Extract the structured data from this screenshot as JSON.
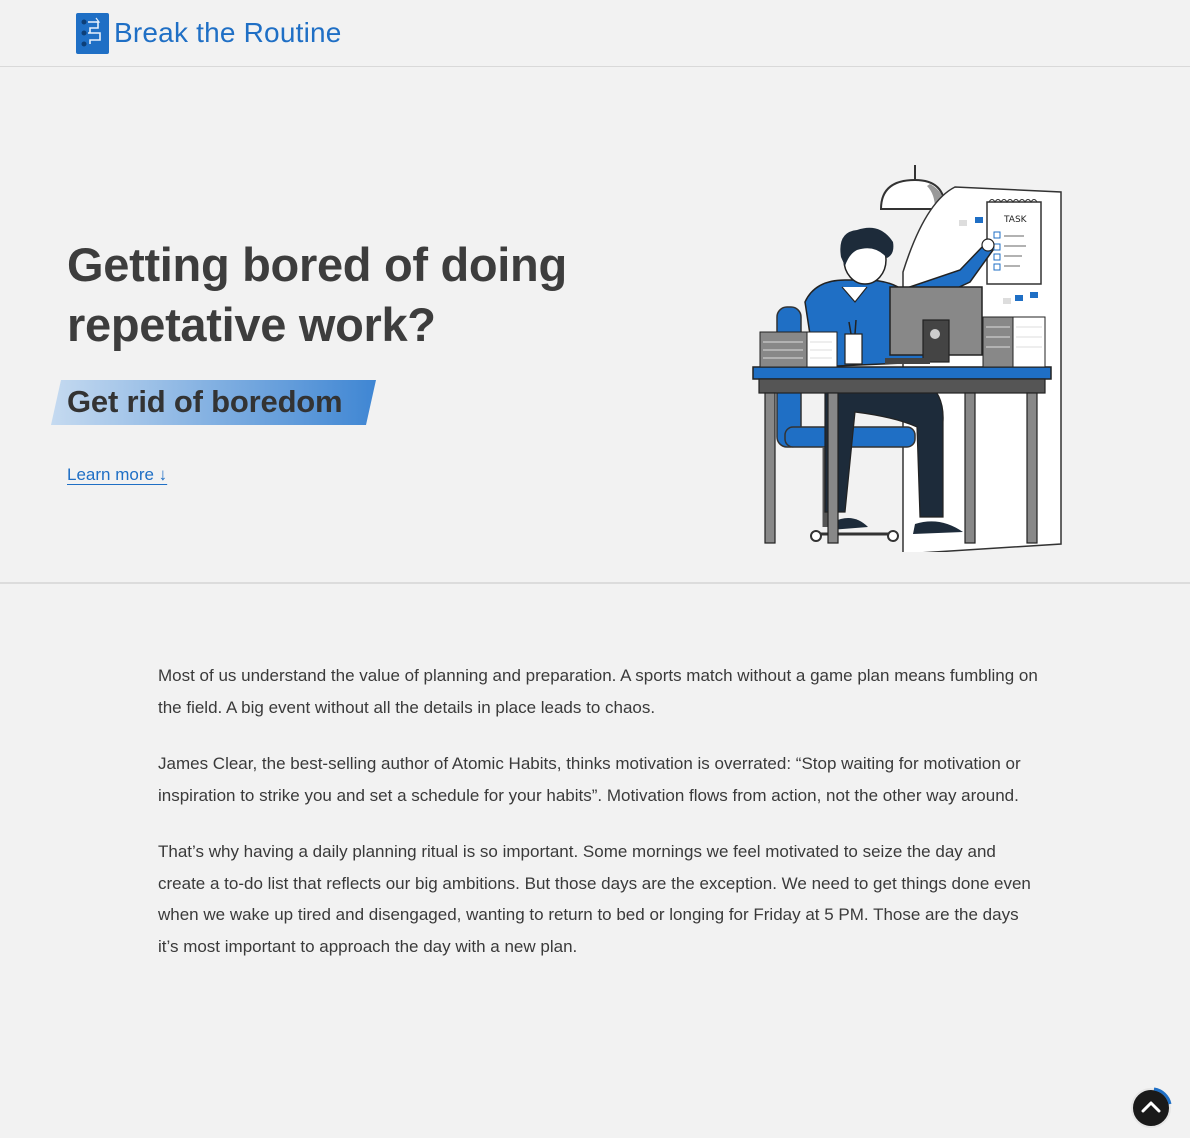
{
  "header": {
    "brand": "Break the Routine",
    "logo_icon": "flowchart-icon"
  },
  "hero": {
    "title": "Getting bored of doing repetative work?",
    "tagline": "Get rid of boredom",
    "learn_more": "Learn more ↓",
    "illustration": {
      "task_board_title": "TASK"
    }
  },
  "article": {
    "paragraphs": [
      "Most of us understand the value of planning and preparation. A sports match without a game plan means fumbling on the field. A big event without all the details in place leads to chaos.",
      "James Clear, the best-selling author of Atomic Habits, thinks motivation is overrated: “Stop waiting for motivation or inspiration to strike you and set a schedule for your habits”. Motivation flows from action, not the other way around.",
      "That’s why having a daily planning ritual is so important. Some mornings we feel motivated to seize the day and create a to-do list that reflects our big ambitions. But those days are the exception. We need to get things done even when we wake up tired and disengaged, wanting to return to bed or longing for Friday at 5 PM. Those are the days it’s most important to approach the day with a new plan."
    ]
  },
  "scroll_top": {
    "icon": "chevron-up-icon"
  },
  "colors": {
    "accent": "#1f6fc5",
    "tagline_gradient_start": "#bcd4ee",
    "tagline_gradient_end": "#3f86d3",
    "background": "#f2f2f2"
  }
}
